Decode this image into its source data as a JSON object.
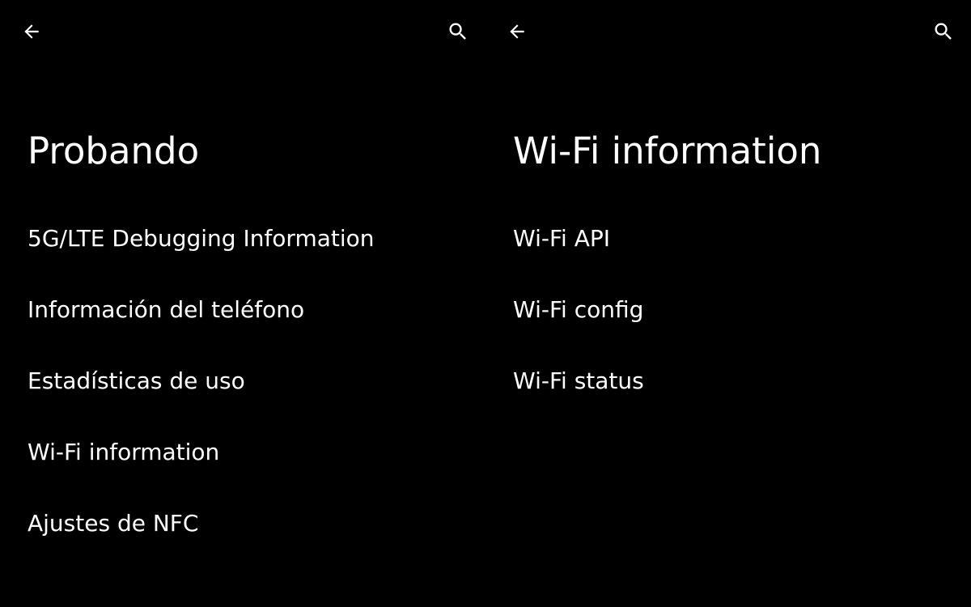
{
  "colors": {
    "background": "#000000",
    "text": "#ffffff"
  },
  "left_panel": {
    "back_icon": "arrow-back-icon",
    "search_icon": "search-icon",
    "title": "Probando",
    "items": [
      {
        "label": "5G/LTE Debugging Information"
      },
      {
        "label": "Información del teléfono"
      },
      {
        "label": "Estadísticas de uso"
      },
      {
        "label": "Wi-Fi information"
      },
      {
        "label": "Ajustes de NFC"
      }
    ]
  },
  "right_panel": {
    "back_icon": "arrow-back-icon",
    "search_icon": "search-icon",
    "title": "Wi-Fi information",
    "items": [
      {
        "label": "Wi-Fi API"
      },
      {
        "label": "Wi-Fi config"
      },
      {
        "label": "Wi-Fi status"
      }
    ]
  }
}
